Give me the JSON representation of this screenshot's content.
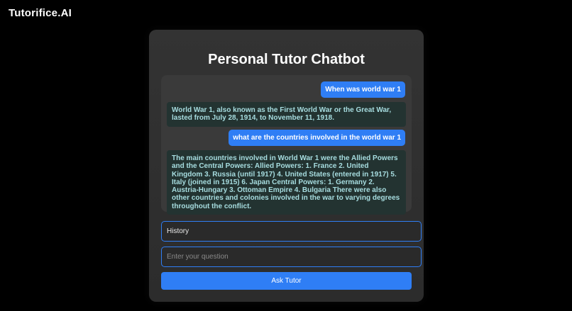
{
  "brand": {
    "name": "Tutorifice.AI"
  },
  "card": {
    "title": "Personal Tutor Chatbot"
  },
  "chat": {
    "messages": [
      {
        "role": "user",
        "text": "When was world war 1"
      },
      {
        "role": "bot",
        "text": "World War 1, also known as the First World War or the Great War, lasted from July 28, 1914, to November 11, 1918."
      },
      {
        "role": "user",
        "text": "what are the countries involved in the world war 1"
      },
      {
        "role": "bot",
        "text": "The main countries involved in World War 1 were the Allied Powers and the Central Powers: Allied Powers: 1. France 2. United Kingdom 3. Russia (until 1917) 4. United States (entered in 1917) 5. Italy (joined in 1915) 6. Japan Central Powers: 1. Germany 2. Austria-Hungary 3. Ottoman Empire 4. Bulgaria There were also other countries and colonies involved in the war to varying degrees throughout the conflict."
      }
    ]
  },
  "form": {
    "subject_value": "History",
    "question_value": "",
    "question_placeholder": "Enter your question",
    "ask_label": "Ask Tutor"
  },
  "colors": {
    "accent": "#2f7ef5",
    "background": "#000000",
    "card": "#333333",
    "bot_text": "#a7dde0"
  }
}
